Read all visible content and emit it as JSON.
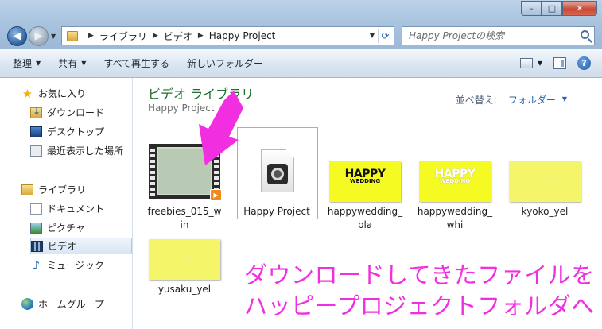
{
  "window": {
    "controls": {
      "minimize": "–",
      "maximize": "□",
      "close": "✕"
    }
  },
  "address_bar": {
    "crumbs": [
      "ライブラリ",
      "ビデオ",
      "Happy Project"
    ]
  },
  "search": {
    "placeholder": "Happy Projectの検索"
  },
  "toolbar": {
    "organize": "整理",
    "share": "共有",
    "play_all": "すべて再生する",
    "new_folder": "新しいフォルダー"
  },
  "sidebar": {
    "favorites": "お気に入り",
    "downloads": "ダウンロード",
    "desktop": "デスクトップ",
    "recent": "最近表示した場所",
    "libraries": "ライブラリ",
    "documents": "ドキュメント",
    "pictures": "ピクチャ",
    "videos": "ビデオ",
    "music": "ミュージック",
    "homegroup": "ホームグループ"
  },
  "content": {
    "title": "ビデオ ライブラリ",
    "subtitle": "Happy Project",
    "sort_label": "並べ替え:",
    "sort_value": "フォルダー",
    "files": [
      {
        "name_l1": "freebies_015_w",
        "name_l2": "in"
      },
      {
        "name_l1": "Happy Project",
        "name_l2": ""
      },
      {
        "name_l1": "happywedding_",
        "name_l2": "bla"
      },
      {
        "name_l1": "happywedding_",
        "name_l2": "whi"
      },
      {
        "name_l1": "kyoko_yel",
        "name_l2": ""
      },
      {
        "name_l1": "yusaku_yel",
        "name_l2": ""
      }
    ],
    "thumb_text": {
      "line1": "HAPPY",
      "line2": "WEDDING"
    }
  },
  "annotation": {
    "line1": "ダウンロードしてきたファイルを",
    "line2": "ハッピープロジェクトフォルダへ",
    "color": "#f22fe0"
  }
}
